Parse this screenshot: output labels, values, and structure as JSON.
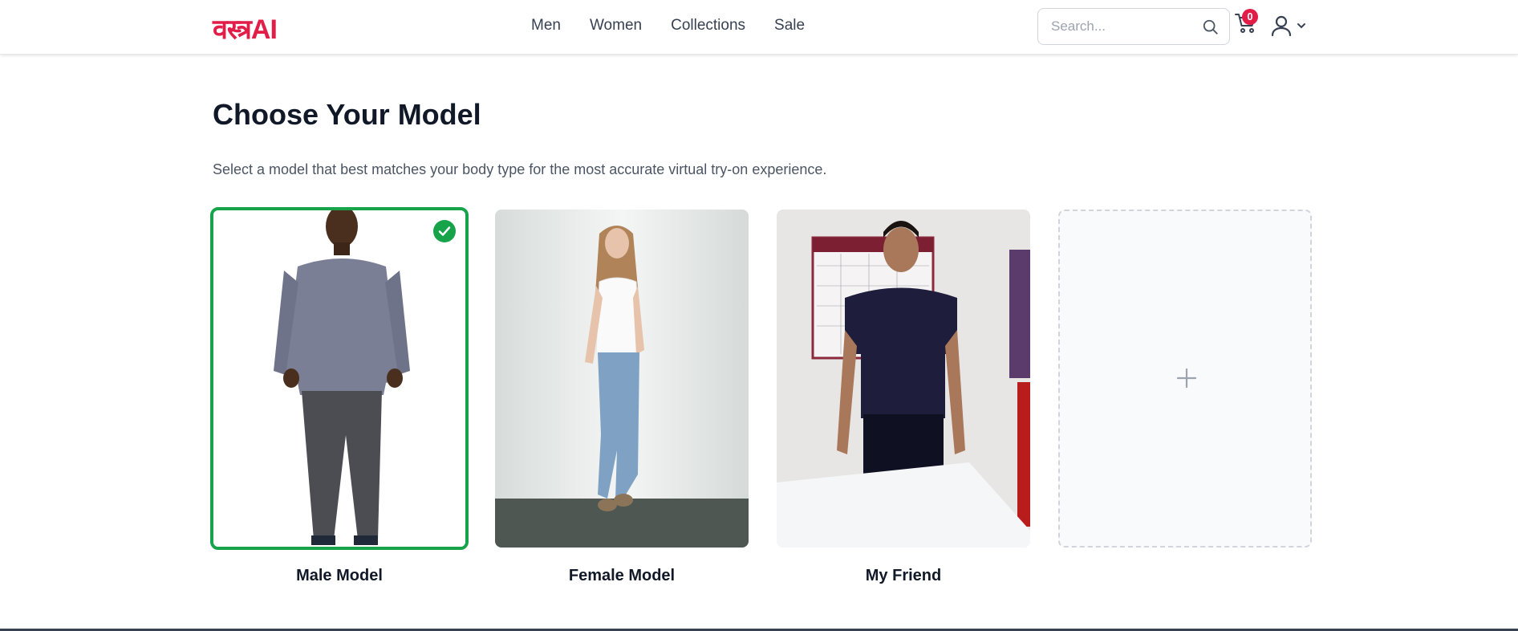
{
  "brand": {
    "logo": "वस्त्रAI",
    "accent": "#e11d48"
  },
  "nav": {
    "links": [
      {
        "label": "Men"
      },
      {
        "label": "Women"
      },
      {
        "label": "Collections"
      },
      {
        "label": "Sale"
      }
    ],
    "search_placeholder": "Search...",
    "cart_count": "0",
    "icons": [
      "search-icon",
      "cart-icon",
      "user-icon",
      "chevron-down-icon"
    ]
  },
  "main": {
    "title": "Choose Your Model",
    "subtitle": "Select a model that best matches your body type for the most accurate virtual try-on experience.",
    "models": [
      {
        "label": "Male Model",
        "selected": true
      },
      {
        "label": "Female Model",
        "selected": false
      },
      {
        "label": "My Friend",
        "selected": false
      }
    ],
    "add_model_icon": "plus-icon",
    "selected_color": "#16a34a"
  }
}
